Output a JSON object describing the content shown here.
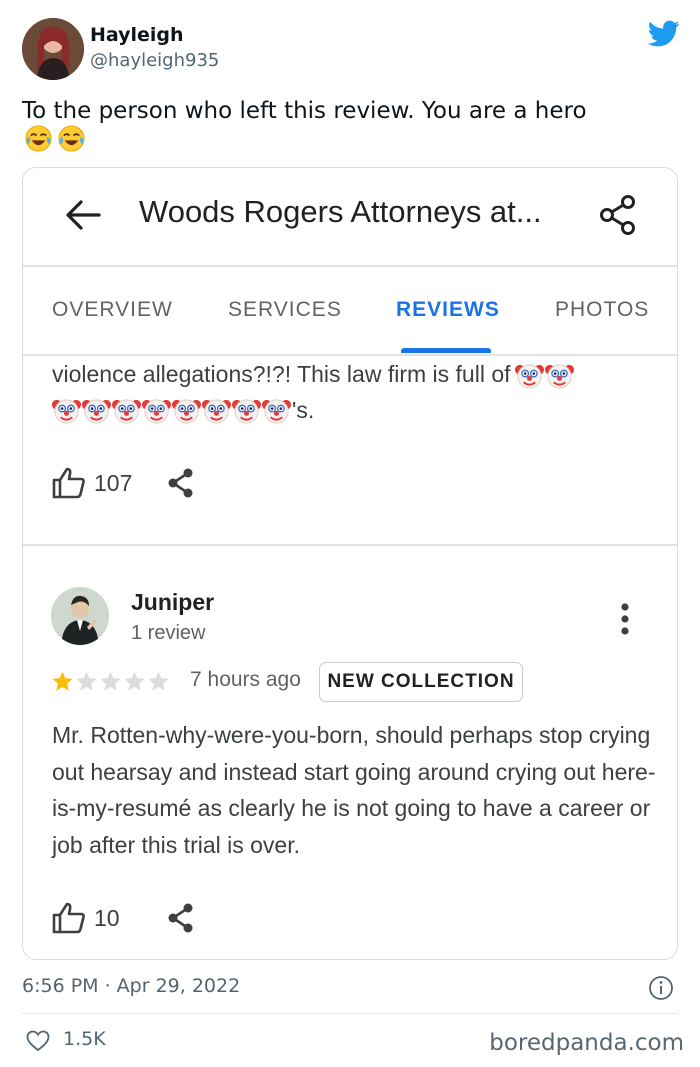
{
  "tweet": {
    "user_name": "Hayleigh",
    "user_handle": "@hayleigh935",
    "text": "To the person who left this review. You are a hero",
    "text_emoji": [
      "face-with-tears-of-joy",
      "face-with-tears-of-joy"
    ],
    "timestamp": "6:56 PM · Apr 29, 2022",
    "likes": "1.5K",
    "brand_color": "#1d9bf0"
  },
  "maps_card": {
    "place_title": "Woods Rogers Attorneys at...",
    "tabs": [
      {
        "label": "OVERVIEW",
        "active": false
      },
      {
        "label": "SERVICES",
        "active": false
      },
      {
        "label": "REVIEWS",
        "active": true
      },
      {
        "label": "PHOTOS",
        "active": false
      }
    ],
    "accent_color": "#1a73e8",
    "previous_review": {
      "text_line1": "violence allegations?!?! This law firm is full of",
      "clown_emoji_count_line1": 2,
      "clown_emoji_count_line2": 8,
      "text_line2_suffix": "'s.",
      "likes": "107"
    },
    "review": {
      "reviewer_name": "Juniper",
      "reviewer_meta": "1 review",
      "rating": 1,
      "rating_max": 5,
      "time_ago": "7 hours ago",
      "badge": "NEW COLLECTION",
      "body": "Mr. Rotten-why-were-you-born, should perhaps stop crying out hearsay and instead start going around crying out here-is-my-resumé as clearly he is not going to have a career or job after this trial is over.",
      "likes": "10"
    }
  },
  "watermark": "boredpanda.com"
}
